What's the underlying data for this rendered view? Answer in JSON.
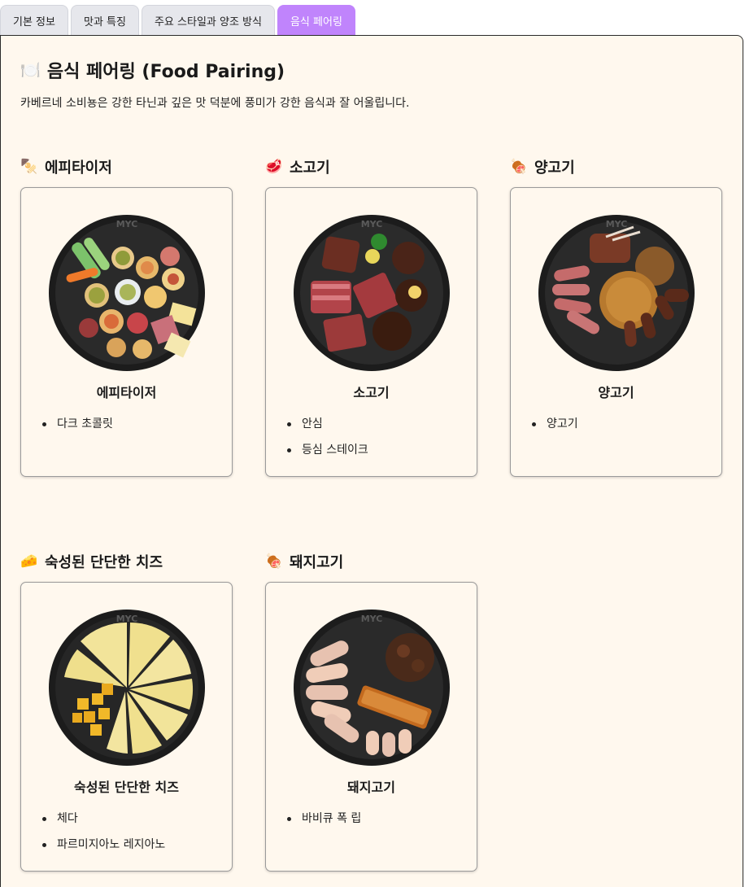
{
  "tabs": [
    {
      "label": "기본 정보",
      "active": false
    },
    {
      "label": "맛과 특징",
      "active": false
    },
    {
      "label": "주요 스타일과 양조 방식",
      "active": false
    },
    {
      "label": "음식 페어링",
      "active": true
    }
  ],
  "page": {
    "title_icon": "fork-knife-plate-icon",
    "title": "음식 페어링 (Food Pairing)",
    "intro": "카베르네 소비뇽은 강한 타닌과 깊은 맛 덕분에 풍미가 강한 음식과 잘 어울립니다."
  },
  "categories": [
    {
      "heading": "에피타이저",
      "icon": "skewer-icon",
      "emoji": "🍢",
      "image": "appetizer-platter",
      "card_title": "에피타이저",
      "items": [
        "다크 초콜릿"
      ]
    },
    {
      "heading": "소고기",
      "icon": "meat-icon",
      "emoji": "🥩",
      "image": "beef-platter",
      "card_title": "소고기",
      "items": [
        "안심",
        "등심 스테이크"
      ]
    },
    {
      "heading": "양고기",
      "icon": "drumstick-icon",
      "emoji": "🍖",
      "image": "lamb-platter",
      "card_title": "양고기",
      "items": [
        "양고기"
      ]
    },
    {
      "heading": "숙성된 단단한 치즈",
      "icon": "cheese-icon",
      "emoji": "🧀",
      "image": "cheese-platter",
      "card_title": "숙성된 단단한 치즈",
      "items": [
        "체다",
        "파르미지아노 레지아노"
      ]
    },
    {
      "heading": "돼지고기",
      "icon": "drumstick-icon",
      "emoji": "🍖",
      "image": "pork-platter",
      "card_title": "돼지고기",
      "items": [
        "바비큐 폭 립"
      ]
    }
  ],
  "watermark": "MYC",
  "colors": {
    "active_tab": "#c084fc",
    "panel_bg": "#fff8ee",
    "plate": "#1c1c1c"
  }
}
